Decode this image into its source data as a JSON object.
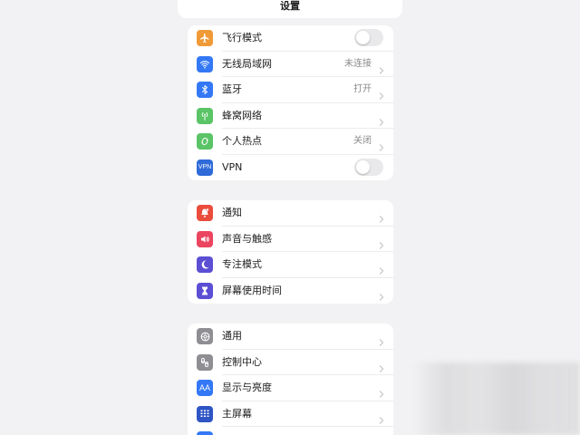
{
  "header": {
    "title": "设置"
  },
  "groups": [
    {
      "rows": [
        {
          "label": "飞行模式",
          "icon": "airplane-icon",
          "color": "#f09a37",
          "control": "toggle",
          "on": false
        },
        {
          "label": "无线局域网",
          "icon": "wifi-icon",
          "color": "#3478f6",
          "value": "未连接",
          "control": "chevron"
        },
        {
          "label": "蓝牙",
          "icon": "bluetooth-icon",
          "color": "#3478f6",
          "value": "打开",
          "control": "chevron"
        },
        {
          "label": "蜂窝网络",
          "icon": "cellular-icon",
          "color": "#5ac466",
          "control": "chevron"
        },
        {
          "label": "个人热点",
          "icon": "hotspot-icon",
          "color": "#5ac466",
          "value": "关闭",
          "control": "chevron"
        },
        {
          "label": "VPN",
          "icon": "vpn-icon",
          "icon_text": "VPN",
          "color": "#2f6bd8",
          "control": "toggle",
          "on": false
        }
      ]
    },
    {
      "rows": [
        {
          "label": "通知",
          "icon": "bell-icon",
          "color": "#eb4d3d",
          "control": "chevron"
        },
        {
          "label": "声音与触感",
          "icon": "speaker-icon",
          "color": "#eb4560",
          "control": "chevron"
        },
        {
          "label": "专注模式",
          "icon": "moon-icon",
          "color": "#5b4fd4",
          "control": "chevron"
        },
        {
          "label": "屏幕使用时间",
          "icon": "hourglass-icon",
          "color": "#5b4fd4",
          "control": "chevron"
        }
      ]
    },
    {
      "rows": [
        {
          "label": "通用",
          "icon": "gear-icon",
          "color": "#8e8e93",
          "control": "chevron"
        },
        {
          "label": "控制中心",
          "icon": "control-center-icon",
          "color": "#8e8e93",
          "control": "chevron"
        },
        {
          "label": "显示与亮度",
          "icon": "display-icon",
          "icon_text": "AA",
          "color": "#3478f6",
          "control": "chevron"
        },
        {
          "label": "主屏幕",
          "icon": "home-screen-icon",
          "color": "#2f55c4",
          "control": "chevron"
        },
        {
          "label": "",
          "icon": "accessibility-icon",
          "color": "#3478f6",
          "control": "chevron"
        }
      ]
    }
  ]
}
